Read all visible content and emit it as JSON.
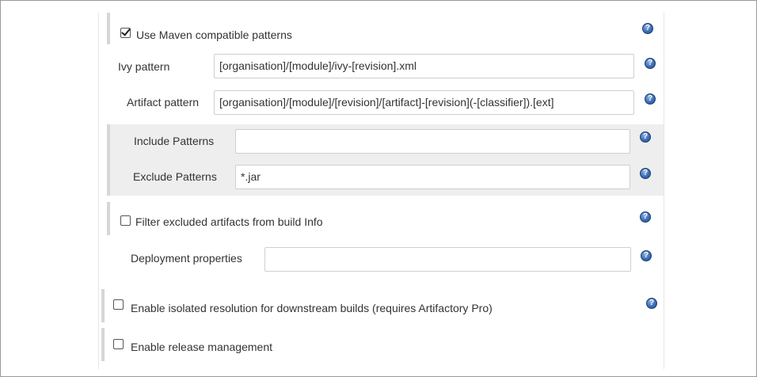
{
  "maven_patterns": {
    "label": "Use Maven compatible patterns",
    "checked": true
  },
  "ivy_pattern": {
    "label": "Ivy pattern",
    "value": "[organisation]/[module]/ivy-[revision].xml"
  },
  "artifact_pattern": {
    "label": "Artifact pattern",
    "value": "[organisation]/[module]/[revision]/[artifact]-[revision](-[classifier]).[ext]"
  },
  "include_patterns": {
    "label": "Include Patterns",
    "value": ""
  },
  "exclude_patterns": {
    "label": "Exclude Patterns",
    "value": "*.jar"
  },
  "filter_excluded": {
    "label": "Filter excluded artifacts from build Info",
    "checked": false
  },
  "deployment_properties": {
    "label": "Deployment properties",
    "value": ""
  },
  "isolated_resolution": {
    "label": "Enable isolated resolution for downstream builds (requires Artifactory Pro)",
    "checked": false
  },
  "release_management": {
    "label": "Enable release management",
    "checked": false
  },
  "help_icon": {
    "name": "help-icon",
    "glyph": "?",
    "color": "#3c6db3"
  }
}
